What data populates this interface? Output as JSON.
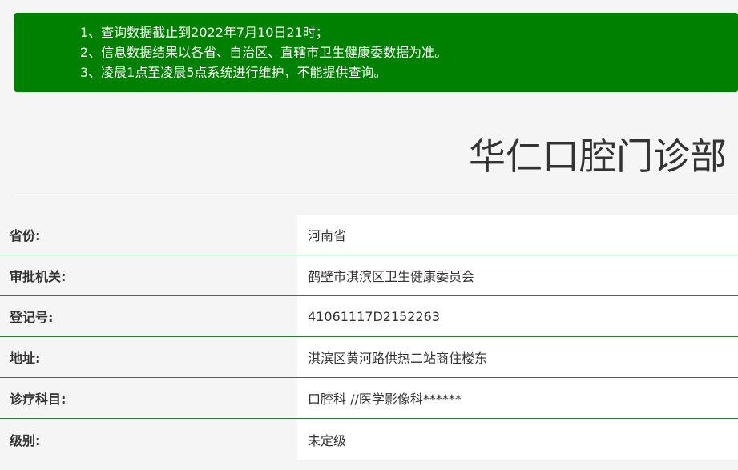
{
  "notice": {
    "lines": [
      "1、查询数据截止到2022年7月10日21时；",
      "2、信息数据结果以各省、自治区、直辖市卫生健康委数据为准。",
      "3、凌晨1点至凌晨5点系统进行维护，不能提供查询。"
    ],
    "background_color": "#008000"
  },
  "header": {
    "title": "华仁口腔门诊部"
  },
  "info": {
    "rows": [
      {
        "label": "省份:",
        "value": "河南省"
      },
      {
        "label": "审批机关:",
        "value": "鹤壁市淇滨区卫生健康委员会"
      },
      {
        "label": "登记号:",
        "value": "41061117D2152263"
      },
      {
        "label": "地址:",
        "value": "淇滨区黄河路供热二站商住楼东"
      },
      {
        "label": "诊疗科目:",
        "value": "口腔科 //医学影像科******"
      },
      {
        "label": "级别:",
        "value": "未定级"
      }
    ]
  },
  "colors": {
    "accent": "#008000",
    "row_divider": "#2a7a3a",
    "text": "#333333"
  }
}
